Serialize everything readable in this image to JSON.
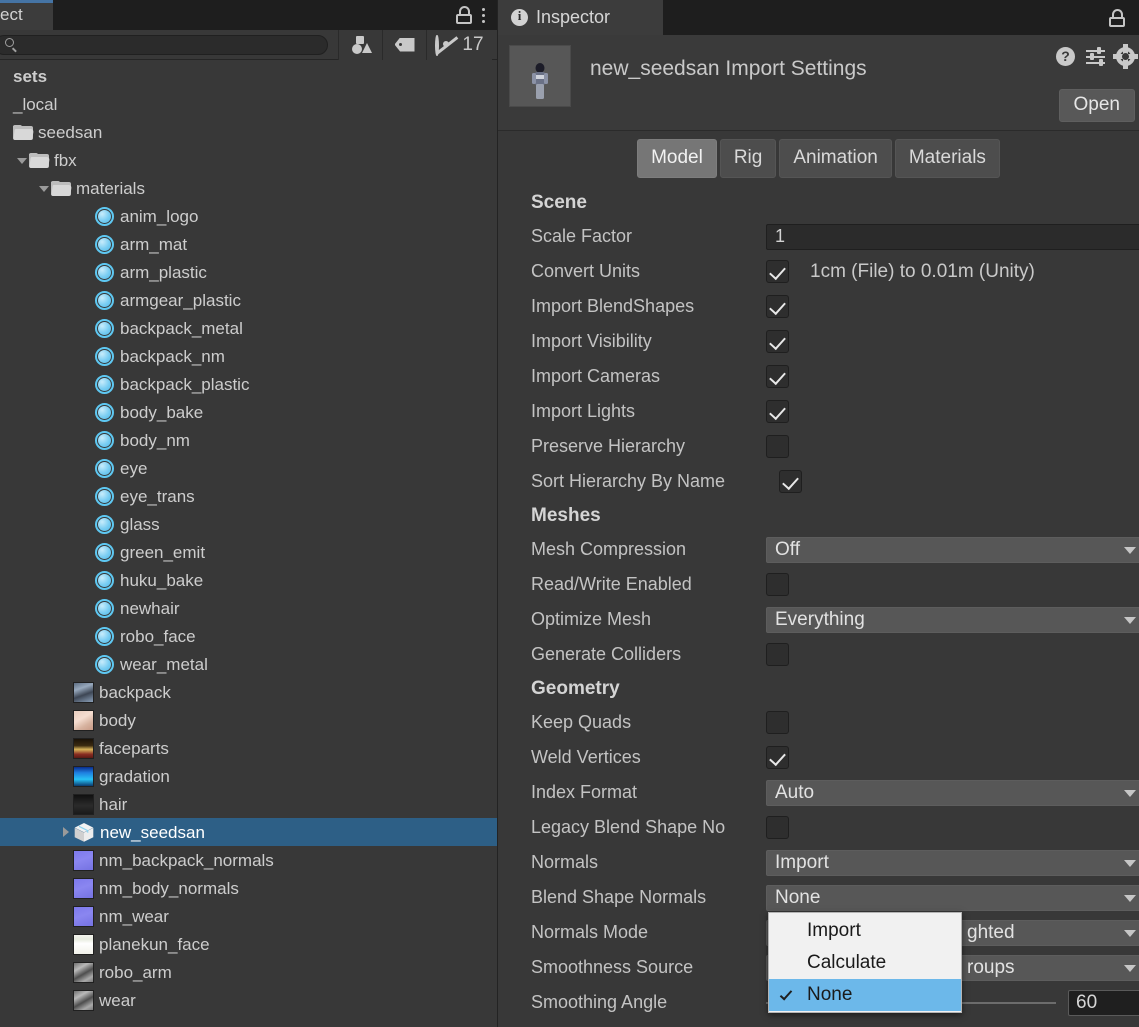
{
  "project_panel": {
    "tab_label": "ect",
    "tab_full_label": "Project",
    "lock_icon": "lock-icon",
    "menu_icon": "kebab-menu-icon",
    "search": {
      "value": "",
      "placeholder": "",
      "icon": "search-icon"
    },
    "toolbar": {
      "asset_type_filter_icon": "asset-type-filter-icon",
      "label_filter_icon": "label-tag-icon",
      "hidden_items_icon": "eye-off-icon",
      "hidden_items_count": "17"
    },
    "tree": [
      {
        "label": "sets",
        "type": "folder-root",
        "indent": 0,
        "twirl": "none",
        "icon": "none"
      },
      {
        "label": "_local",
        "type": "folder",
        "indent": 0,
        "twirl": "none",
        "icon": "none"
      },
      {
        "label": "seedsan",
        "type": "folder",
        "indent": 0,
        "twirl": "none",
        "icon": "folder"
      },
      {
        "label": "fbx",
        "type": "folder",
        "indent": 1,
        "twirl": "down",
        "icon": "folder"
      },
      {
        "label": "materials",
        "type": "folder",
        "indent": 2,
        "twirl": "down",
        "icon": "folder"
      },
      {
        "label": "anim_logo",
        "type": "material",
        "indent": 4,
        "twirl": "none",
        "icon": "material"
      },
      {
        "label": "arm_mat",
        "type": "material",
        "indent": 4,
        "twirl": "none",
        "icon": "material"
      },
      {
        "label": "arm_plastic",
        "type": "material",
        "indent": 4,
        "twirl": "none",
        "icon": "material"
      },
      {
        "label": "armgear_plastic",
        "type": "material",
        "indent": 4,
        "twirl": "none",
        "icon": "material"
      },
      {
        "label": "backpack_metal",
        "type": "material",
        "indent": 4,
        "twirl": "none",
        "icon": "material"
      },
      {
        "label": "backpack_nm",
        "type": "material",
        "indent": 4,
        "twirl": "none",
        "icon": "material"
      },
      {
        "label": "backpack_plastic",
        "type": "material",
        "indent": 4,
        "twirl": "none",
        "icon": "material"
      },
      {
        "label": "body_bake",
        "type": "material",
        "indent": 4,
        "twirl": "none",
        "icon": "material"
      },
      {
        "label": "body_nm",
        "type": "material",
        "indent": 4,
        "twirl": "none",
        "icon": "material"
      },
      {
        "label": "eye",
        "type": "material",
        "indent": 4,
        "twirl": "none",
        "icon": "material"
      },
      {
        "label": "eye_trans",
        "type": "material",
        "indent": 4,
        "twirl": "none",
        "icon": "material"
      },
      {
        "label": "glass",
        "type": "material",
        "indent": 4,
        "twirl": "none",
        "icon": "material"
      },
      {
        "label": "green_emit",
        "type": "material",
        "indent": 4,
        "twirl": "none",
        "icon": "material"
      },
      {
        "label": "huku_bake",
        "type": "material",
        "indent": 4,
        "twirl": "none",
        "icon": "material"
      },
      {
        "label": "newhair",
        "type": "material",
        "indent": 4,
        "twirl": "none",
        "icon": "material"
      },
      {
        "label": "robo_face",
        "type": "material",
        "indent": 4,
        "twirl": "none",
        "icon": "material"
      },
      {
        "label": "wear_metal",
        "type": "material",
        "indent": 4,
        "twirl": "none",
        "icon": "material"
      },
      {
        "label": "backpack",
        "type": "texture",
        "indent": 3,
        "twirl": "none",
        "icon": "texture",
        "swatch": "backpack"
      },
      {
        "label": "body",
        "type": "texture",
        "indent": 3,
        "twirl": "none",
        "icon": "texture",
        "swatch": "body"
      },
      {
        "label": "faceparts",
        "type": "texture",
        "indent": 3,
        "twirl": "none",
        "icon": "texture",
        "swatch": "faceparts"
      },
      {
        "label": "gradation",
        "type": "texture",
        "indent": 3,
        "twirl": "none",
        "icon": "texture",
        "swatch": "gradation"
      },
      {
        "label": "hair",
        "type": "texture",
        "indent": 3,
        "twirl": "none",
        "icon": "texture",
        "swatch": "hair"
      },
      {
        "label": "new_seedsan",
        "type": "model",
        "indent": 3,
        "twirl": "right",
        "icon": "fbx",
        "selected": true
      },
      {
        "label": "nm_backpack_normals",
        "type": "texture",
        "indent": 3,
        "twirl": "none",
        "icon": "texture",
        "swatch": "normal"
      },
      {
        "label": "nm_body_normals",
        "type": "texture",
        "indent": 3,
        "twirl": "none",
        "icon": "texture",
        "swatch": "normal"
      },
      {
        "label": "nm_wear",
        "type": "texture",
        "indent": 3,
        "twirl": "none",
        "icon": "texture",
        "swatch": "normal"
      },
      {
        "label": "planekun_face",
        "type": "texture",
        "indent": 3,
        "twirl": "none",
        "icon": "texture",
        "swatch": "planekun"
      },
      {
        "label": "robo_arm",
        "type": "texture",
        "indent": 3,
        "twirl": "none",
        "icon": "texture",
        "swatch": "gray"
      },
      {
        "label": "wear",
        "type": "texture",
        "indent": 3,
        "twirl": "none",
        "icon": "texture",
        "swatch": "gray"
      }
    ]
  },
  "inspector": {
    "tab_label": "Inspector",
    "info_icon": "info-icon",
    "lock_icon": "lock-icon",
    "title": "new_seedsan Import Settings",
    "thumbnail_alt": "model-preview",
    "header_icons": {
      "help": "help-icon",
      "preset": "preset-icon",
      "settings": "gear-icon"
    },
    "open_button": "Open",
    "tabs": [
      {
        "label": "Model",
        "active": true
      },
      {
        "label": "Rig",
        "active": false
      },
      {
        "label": "Animation",
        "active": false
      },
      {
        "label": "Materials",
        "active": false
      }
    ],
    "sections": [
      {
        "title": "Scene",
        "rows": [
          {
            "label": "Scale Factor",
            "control": "text",
            "value": "1"
          },
          {
            "label": "Convert Units",
            "control": "checkbox",
            "checked": true,
            "suffix": "1cm (File) to 0.01m (Unity)"
          },
          {
            "label": "Import BlendShapes",
            "control": "checkbox",
            "checked": true
          },
          {
            "label": "Import Visibility",
            "control": "checkbox",
            "checked": true
          },
          {
            "label": "Import Cameras",
            "control": "checkbox",
            "checked": true
          },
          {
            "label": "Import Lights",
            "control": "checkbox",
            "checked": true
          },
          {
            "label": "Preserve Hierarchy",
            "control": "checkbox",
            "checked": false
          },
          {
            "label": "Sort Hierarchy By Name",
            "control": "checkbox",
            "checked": true,
            "label_wide": true
          }
        ]
      },
      {
        "title": "Meshes",
        "rows": [
          {
            "label": "Mesh Compression",
            "control": "dropdown",
            "value": "Off"
          },
          {
            "label": "Read/Write Enabled",
            "control": "checkbox",
            "checked": false
          },
          {
            "label": "Optimize Mesh",
            "control": "dropdown",
            "value": "Everything"
          },
          {
            "label": "Generate Colliders",
            "control": "checkbox",
            "checked": false
          }
        ]
      },
      {
        "title": "Geometry",
        "rows": [
          {
            "label": "Keep Quads",
            "control": "checkbox",
            "checked": false
          },
          {
            "label": "Weld Vertices",
            "control": "checkbox",
            "checked": true
          },
          {
            "label": "Index Format",
            "control": "dropdown",
            "value": "Auto"
          },
          {
            "label": "Legacy Blend Shape No",
            "control": "checkbox",
            "checked": false,
            "truncated": true
          },
          {
            "label": "Normals",
            "control": "dropdown",
            "value": "Import"
          },
          {
            "label": "Blend Shape Normals",
            "control": "dropdown",
            "value": "None"
          },
          {
            "label": "Normals Mode",
            "control": "dropdown",
            "value": "ghted",
            "full_value": "Area And Angle Weighted",
            "occluded": true
          },
          {
            "label": "Smoothness Source",
            "control": "dropdown",
            "value": "roups",
            "full_value": "Prefer Smoothing Groups",
            "occluded": true
          },
          {
            "label": "Smoothing Angle",
            "control": "slider",
            "value": "60"
          }
        ]
      }
    ],
    "dropdown_popup": {
      "open_for": "Blend Shape Normals",
      "items": [
        {
          "label": "Import",
          "selected": false
        },
        {
          "label": "Calculate",
          "selected": false
        },
        {
          "label": "None",
          "selected": true
        }
      ]
    }
  },
  "colors": {
    "panel_bg": "#383838",
    "tabbar_bg": "#1e1e1e",
    "selection_blue": "#2d5f86",
    "tab_accent": "#4574a5",
    "popup_bg": "#f1f1f1",
    "popup_highlight": "#6cb8ea",
    "material_icon": "#5ec8f2",
    "dropdown_bg": "#575757"
  }
}
